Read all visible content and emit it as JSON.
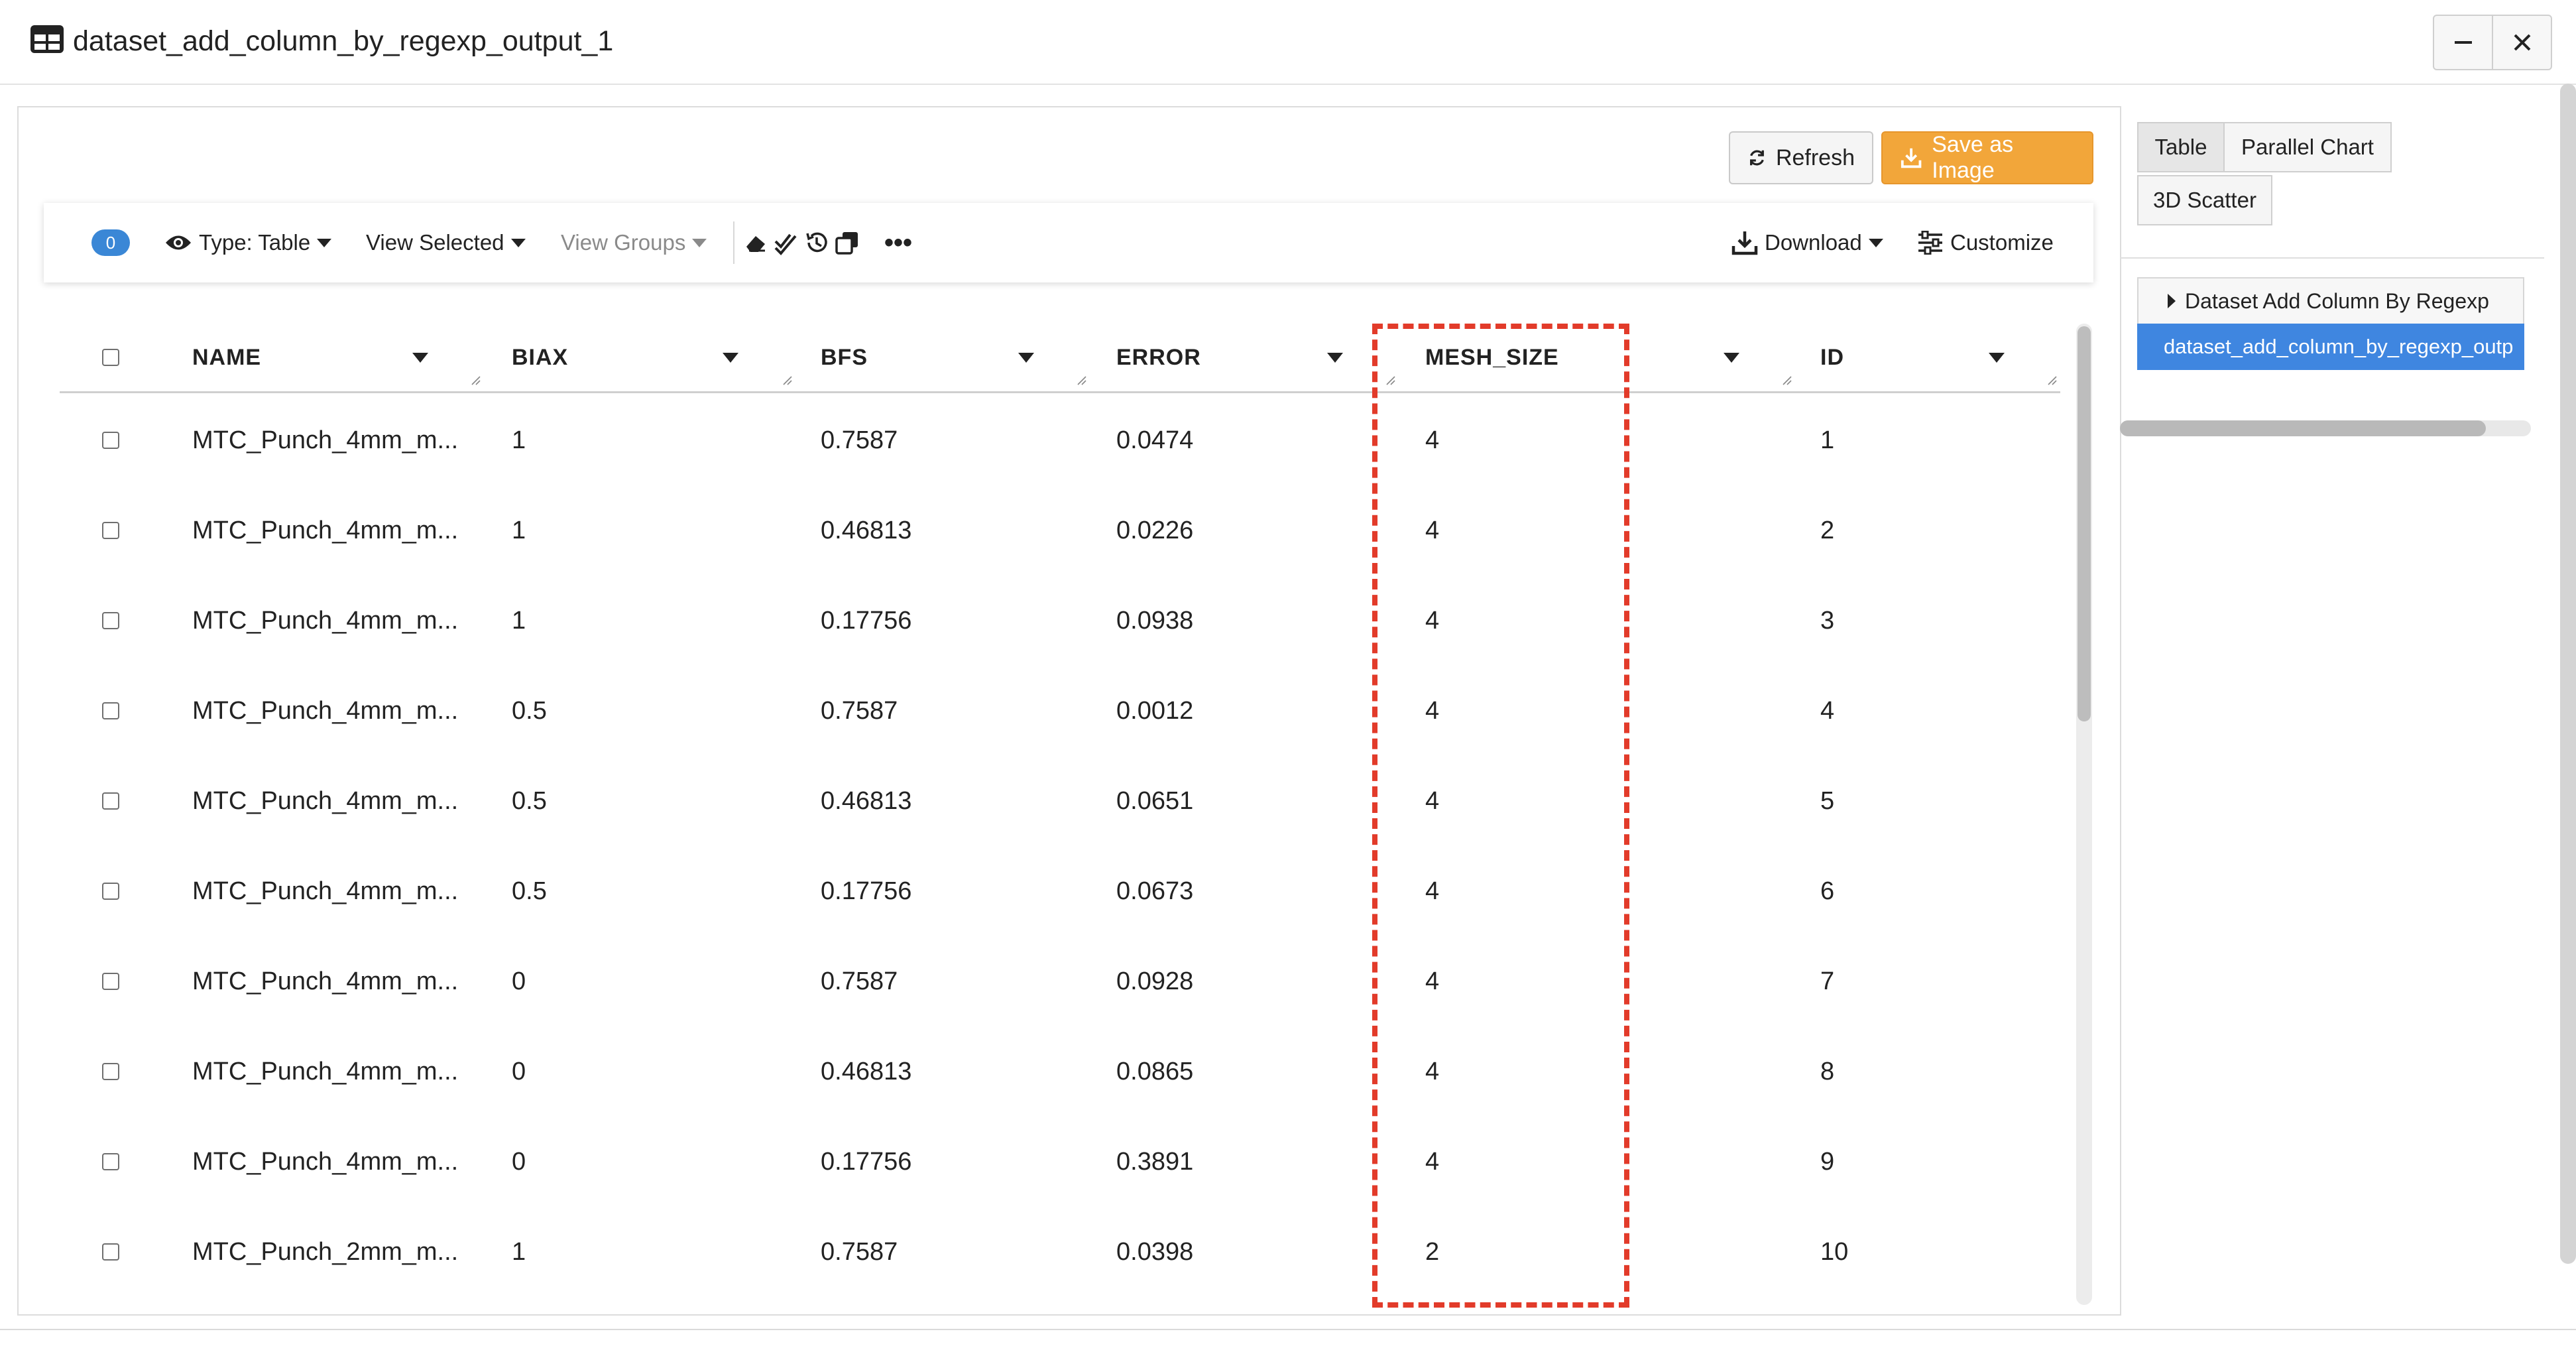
{
  "window": {
    "title": "dataset_add_column_by_regexp_output_1",
    "icon": "table-icon",
    "controls": [
      "minimize-icon",
      "close-icon"
    ]
  },
  "actions": {
    "refresh_label": "Refresh",
    "save_label": "Save as Image",
    "save_color": "#f2a63a"
  },
  "toolbar": {
    "selected_count": "0",
    "type_label": "Type: Table",
    "view_selected_label": "View Selected",
    "view_groups_label": "View Groups",
    "more_label": "•••",
    "download_label": "Download",
    "customize_label": "Customize",
    "tool_icons": [
      "eraser-icon",
      "double-check-icon",
      "history-icon",
      "copy-icon"
    ]
  },
  "table": {
    "columns": [
      "NAME",
      "BIAX",
      "BFS",
      "ERROR",
      "MESH_SIZE",
      "ID"
    ],
    "rows": [
      {
        "name": "MTC_Punch_4mm_m...",
        "biax": "1",
        "bfs": "0.7587",
        "error": "0.0474",
        "mesh_size": "4",
        "id": "1"
      },
      {
        "name": "MTC_Punch_4mm_m...",
        "biax": "1",
        "bfs": "0.46813",
        "error": "0.0226",
        "mesh_size": "4",
        "id": "2"
      },
      {
        "name": "MTC_Punch_4mm_m...",
        "biax": "1",
        "bfs": "0.17756",
        "error": "0.0938",
        "mesh_size": "4",
        "id": "3"
      },
      {
        "name": "MTC_Punch_4mm_m...",
        "biax": "0.5",
        "bfs": "0.7587",
        "error": "0.0012",
        "mesh_size": "4",
        "id": "4"
      },
      {
        "name": "MTC_Punch_4mm_m...",
        "biax": "0.5",
        "bfs": "0.46813",
        "error": "0.0651",
        "mesh_size": "4",
        "id": "5"
      },
      {
        "name": "MTC_Punch_4mm_m...",
        "biax": "0.5",
        "bfs": "0.17756",
        "error": "0.0673",
        "mesh_size": "4",
        "id": "6"
      },
      {
        "name": "MTC_Punch_4mm_m...",
        "biax": "0",
        "bfs": "0.7587",
        "error": "0.0928",
        "mesh_size": "4",
        "id": "7"
      },
      {
        "name": "MTC_Punch_4mm_m...",
        "biax": "0",
        "bfs": "0.46813",
        "error": "0.0865",
        "mesh_size": "4",
        "id": "8"
      },
      {
        "name": "MTC_Punch_4mm_m...",
        "biax": "0",
        "bfs": "0.17756",
        "error": "0.3891",
        "mesh_size": "4",
        "id": "9"
      },
      {
        "name": "MTC_Punch_2mm_m...",
        "biax": "1",
        "bfs": "0.7587",
        "error": "0.0398",
        "mesh_size": "2",
        "id": "10"
      }
    ],
    "highlight_color": "#e23b2a"
  },
  "side": {
    "tabs": [
      "Table",
      "Parallel Chart",
      "3D Scatter"
    ],
    "active_tab": "Table",
    "tree_header": "Dataset Add Column By Regexp",
    "tree_item": "dataset_add_column_by_regexp_outp",
    "tree_item_color": "#3f86e0"
  }
}
